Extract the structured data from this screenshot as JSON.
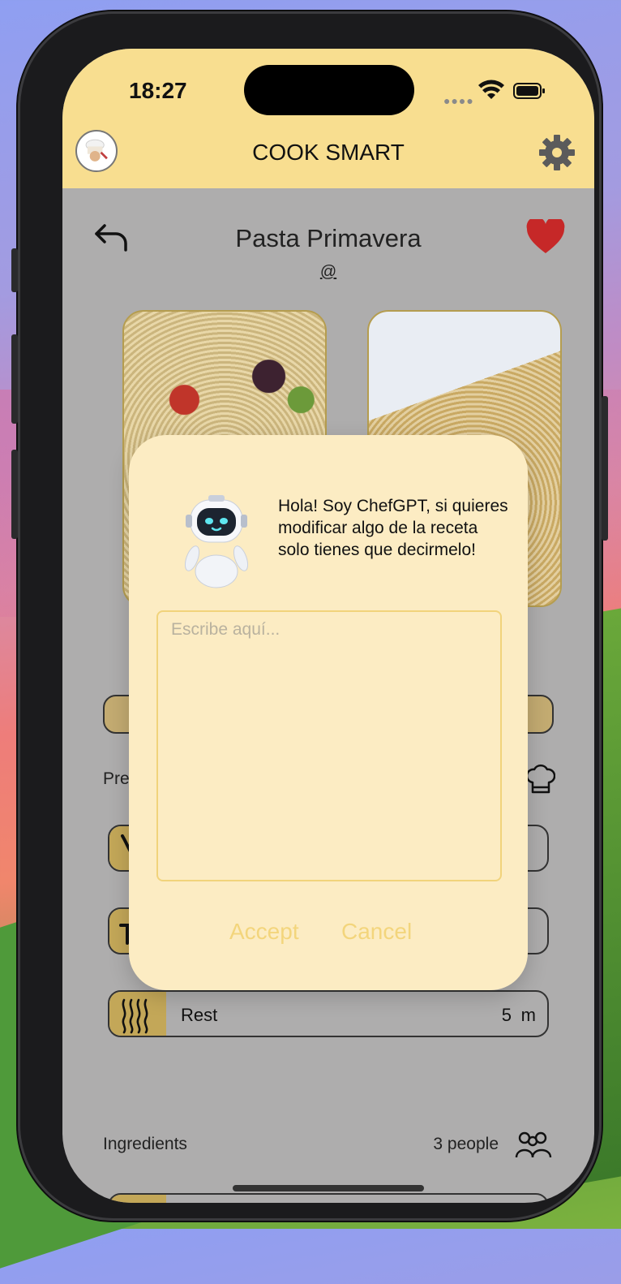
{
  "status_bar": {
    "time": "18:27"
  },
  "header": {
    "app_title": "COOK SMART",
    "settings_icon": "gear-icon",
    "avatar_icon": "chef-avatar"
  },
  "recipe": {
    "title": "Pasta Primavera",
    "author": "@",
    "favorite_icon": "heart-icon",
    "favorite_color": "#c62828",
    "back_icon": "back-arrow-icon"
  },
  "preparation": {
    "label": "Pre",
    "steps": [
      {
        "name": "",
        "time": "",
        "unit": "",
        "icon": "knife-icon"
      },
      {
        "name": "",
        "time": "",
        "unit": "",
        "icon": "pot-icon"
      },
      {
        "name": "Rest",
        "time": "5",
        "unit": "m",
        "icon": "steam-icon"
      }
    ]
  },
  "ingredients": {
    "label": "Ingredients",
    "people": "3 people",
    "people_icon": "people-icon"
  },
  "dialog": {
    "message": "Hola! Soy ChefGPT, si quieres modificar algo de la receta solo tienes que decirmelo!",
    "input_placeholder": "Escribe aquí...",
    "input_value": "",
    "accept_label": "Accept",
    "cancel_label": "Cancel",
    "accent_color": "#f3d57c"
  },
  "colors": {
    "header_bg": "#f8de90",
    "overlay_bg": "#aeadad",
    "modal_bg": "#fcecc3",
    "step_icon_bg": "#c3a758"
  }
}
